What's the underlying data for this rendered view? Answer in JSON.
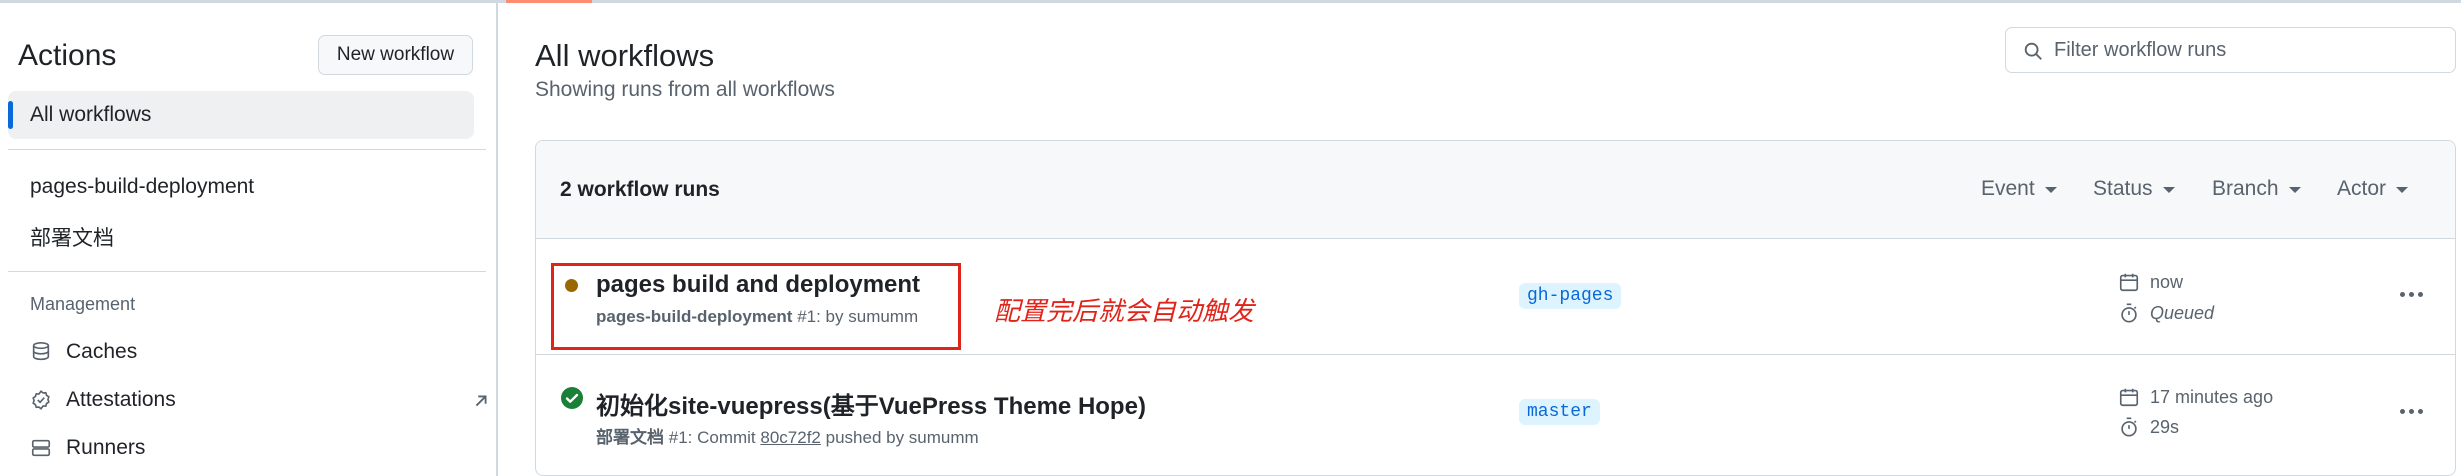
{
  "sidebar": {
    "title": "Actions",
    "new_workflow_label": "New workflow",
    "all_workflows_label": "All workflows",
    "workflows": [
      {
        "label": "pages-build-deployment"
      },
      {
        "label": "部署文档"
      }
    ],
    "management_heading": "Management",
    "management_items": [
      {
        "label": "Caches",
        "icon": "database-icon"
      },
      {
        "label": "Attestations",
        "icon": "verified-icon",
        "external": true
      },
      {
        "label": "Runners",
        "icon": "server-icon"
      }
    ]
  },
  "main": {
    "title": "All workflows",
    "subtitle": "Showing runs from all workflows",
    "filter_placeholder": "Filter workflow runs",
    "runs_count_label": "2 workflow runs",
    "filters": [
      {
        "label": "Event"
      },
      {
        "label": "Status"
      },
      {
        "label": "Branch"
      },
      {
        "label": "Actor"
      }
    ],
    "runs": [
      {
        "title": "pages build and deployment",
        "workflow_name": "pages-build-deployment",
        "meta_suffix": "#1: by sumumm",
        "branch": "gh-pages",
        "when": "now",
        "duration": "Queued",
        "status": "queued"
      },
      {
        "title": "初始化site-vuepress(基于VuePress Theme Hope)",
        "workflow_name": "部署文档",
        "meta_pre": "#1: Commit",
        "commit": "80c72f2",
        "meta_post": "pushed by sumumm",
        "branch": "master",
        "when": "17 minutes ago",
        "duration": "29s",
        "status": "success"
      }
    ],
    "annotation": "配置完后就会自动触发"
  },
  "colors": {
    "accent": "#0969da",
    "success": "#1a7f37",
    "queued": "#9a6700",
    "annotation": "#e0241a",
    "tab_underline": "#fd8c73"
  }
}
